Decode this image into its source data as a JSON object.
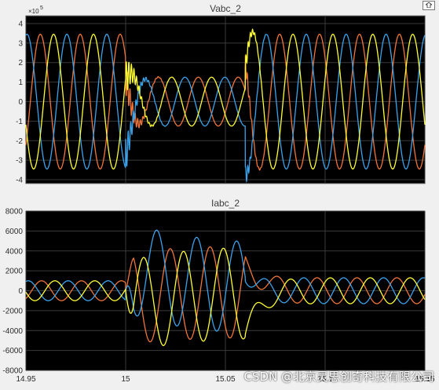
{
  "window": {
    "dock_icon": "undock-icon"
  },
  "colors": {
    "background": "#f0f0f0",
    "axes_bg": "#000000",
    "grid": "#3a3a3a",
    "phase_a": "#ffff36",
    "phase_b": "#3ba3ec",
    "phase_c": "#f0753a"
  },
  "plots": {
    "voltage": {
      "title": "Vabc_2",
      "exponent_label": "×10",
      "exponent_power": "5",
      "yticks": [
        "4",
        "3",
        "2",
        "1",
        "0",
        "-1",
        "-2",
        "-3",
        "-4"
      ]
    },
    "current": {
      "title": "Iabc_2",
      "yticks": [
        "8000",
        "6000",
        "4000",
        "2000",
        "0",
        "-2000",
        "-4000",
        "-6000",
        "-8000"
      ]
    }
  },
  "xticks": [
    "14.95",
    "15",
    "15.05",
    "15.1",
    "15.15"
  ],
  "chart_data": [
    {
      "type": "line",
      "title": "Vabc_2",
      "x_range": [
        14.95,
        15.15
      ],
      "ylim": [
        -4.2,
        4.4
      ],
      "y_multiplier": "×10^5",
      "grid": true,
      "frequency_hz": 50,
      "series": [
        {
          "phase_shift_deg": 0,
          "color": "#ffff36"
        },
        {
          "phase_shift_deg": -120,
          "color": "#3ba3ec"
        },
        {
          "phase_shift_deg": 120,
          "color": "#f0753a"
        }
      ],
      "segments": [
        {
          "x_start": 14.95,
          "x_end": 15.0,
          "amplitude": 3.45
        },
        {
          "x_start": 15.0,
          "x_end": 15.06,
          "amplitude": 1.25
        },
        {
          "x_start": 15.06,
          "x_end": 15.15,
          "amplitude": 3.45
        }
      ],
      "transients": [
        {
          "x": 15.0,
          "peak_positive": 1.7,
          "peak_negative": -2.8
        },
        {
          "x": 15.06,
          "peak_positive": 3.9,
          "peak_negative": -3.0
        }
      ]
    },
    {
      "type": "line",
      "title": "Iabc_2",
      "x_range": [
        14.95,
        15.15
      ],
      "ylim": [
        -8000,
        8000
      ],
      "grid": true,
      "frequency_hz": 50,
      "series": [
        {
          "phase_shift_deg": 0,
          "color": "#ffff36"
        },
        {
          "phase_shift_deg": -120,
          "color": "#3ba3ec"
        },
        {
          "phase_shift_deg": 120,
          "color": "#f0753a"
        }
      ],
      "segments": [
        {
          "x_start": 14.95,
          "x_end": 15.0,
          "amplitude": 1000
        },
        {
          "x_start": 15.0,
          "x_end": 15.06,
          "amplitude_peak": 6400,
          "dc_offset_decay": true
        },
        {
          "x_start": 15.06,
          "x_end": 15.15,
          "amplitude": 1300
        }
      ]
    }
  ],
  "watermark": "CSDN @北京灵思创奇科技有限公司"
}
